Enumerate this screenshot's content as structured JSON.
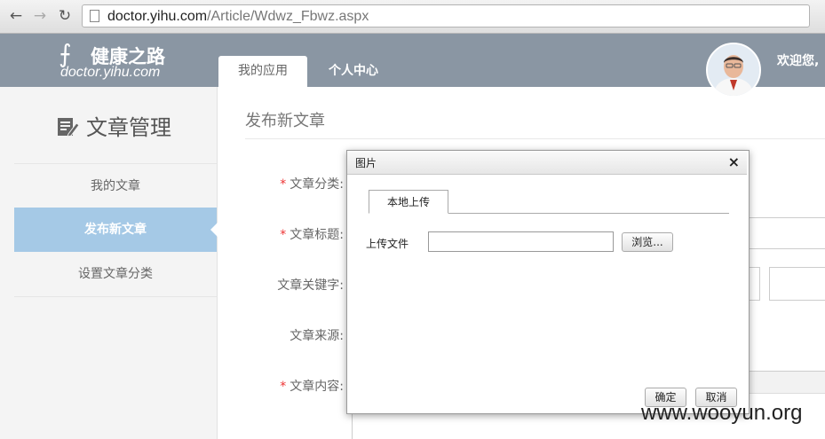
{
  "browser": {
    "url_host": "doctor.yihu.com",
    "url_path": "/Article/Wdwz_Fbwz.aspx"
  },
  "site": {
    "logo_cn": "健康之路",
    "logo_en": "doctor.yihu.com",
    "tabs": [
      {
        "label": "我的应用",
        "active": true
      },
      {
        "label": "个人中心",
        "active": false
      }
    ],
    "welcome": "欢迎您,"
  },
  "sidebar": {
    "title": "文章管理",
    "items": [
      {
        "label": "我的文章",
        "active": false
      },
      {
        "label": "发布新文章",
        "active": true
      },
      {
        "label": "设置文章分类",
        "active": false
      }
    ]
  },
  "main": {
    "title": "发布新文章",
    "fields": [
      {
        "label": "文章分类:",
        "required": true
      },
      {
        "label": "文章标题:",
        "required": true
      },
      {
        "label": "文章关键字:",
        "required": false
      },
      {
        "label": "文章来源:",
        "required": false
      },
      {
        "label": "文章内容:",
        "required": true
      }
    ],
    "required_mark": "*"
  },
  "dialog": {
    "title": "图片",
    "close_glyph": "×",
    "tab": "本地上传",
    "file_label": "上传文件",
    "browse": "浏览...",
    "ok": "确定",
    "cancel": "取消"
  },
  "watermark": "www.wooyun.org",
  "colors": {
    "header_bg": "#8a96a3",
    "sidebar_active": "#a5c9e6",
    "required": "#ee3333"
  }
}
